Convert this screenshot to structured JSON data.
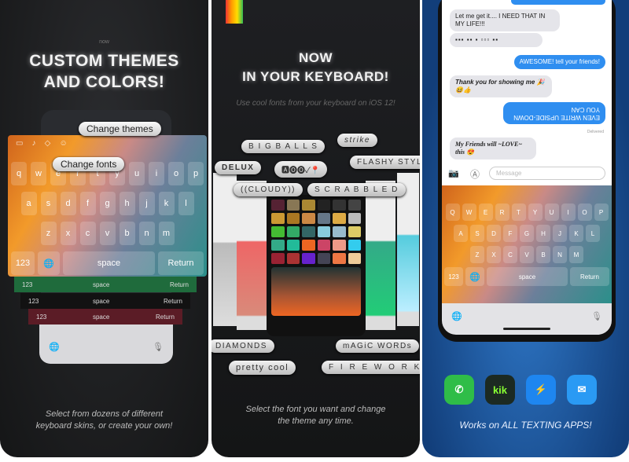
{
  "panel1": {
    "small_label": "now",
    "title_line1": "CUSTOM THEMES",
    "title_line2": "AND COLORS!",
    "tooltip_themes": "Change themes",
    "tooltip_fonts": "Change fonts",
    "keys_row1": [
      "q",
      "w",
      "e",
      "r",
      "t",
      "y",
      "u",
      "i",
      "o",
      "p"
    ],
    "keys_row2": [
      "a",
      "s",
      "d",
      "f",
      "g",
      "h",
      "j",
      "k",
      "l"
    ],
    "keys_row3": [
      "z",
      "x",
      "c",
      "v",
      "b",
      "n",
      "m"
    ],
    "key_123": "123",
    "key_space": "space",
    "key_return": "Return",
    "caption_line1": "Select from dozens of different",
    "caption_line2": "keyboard skins, or create your own!"
  },
  "panel2": {
    "title_line1": "NOW",
    "title_line2": "IN YOUR KEYBOARD!",
    "subtitle": "Use cool fonts from your keyboard on iOS 12!",
    "bubbles": [
      "B I G  B A L L S",
      "strike",
      "DELUX",
      "FLASHY STYLE",
      "((CLOUDY))",
      "S C R A B B L E D",
      "DIAMONDS",
      "mAGiC WORDs",
      "pretty cool",
      "F I R E W O R K S"
    ],
    "caption_line1": "Select the font you want and change",
    "caption_line2": "the theme any time."
  },
  "panel3": {
    "messages": [
      {
        "dir": "in",
        "text": "Let me get it.... I NEED THAT IN MY LIFE!!!"
      },
      {
        "dir": "in",
        "text": "▪▪▪ ▪▪ ▪ ▫▫▫ ▪▪"
      },
      {
        "dir": "out",
        "text": "AWESOME! tell your friends!"
      },
      {
        "dir": "in",
        "text": "Thank you for showing me 🎉😆👍"
      },
      {
        "dir": "out",
        "text": "EVEN WRITE UPSIDE-DOWN YOU CAN"
      },
      {
        "dir": "in",
        "text": "My Friends will ~LOVE~ this 😍"
      }
    ],
    "delivered": "Delivered",
    "message_placeholder": "Message",
    "keys_row1": [
      "Q",
      "W",
      "E",
      "R",
      "T",
      "Y",
      "U",
      "I",
      "O",
      "P"
    ],
    "keys_row2": [
      "A",
      "S",
      "D",
      "F",
      "G",
      "H",
      "J",
      "K",
      "L"
    ],
    "keys_row3": [
      "Z",
      "X",
      "C",
      "V",
      "B",
      "N",
      "M"
    ],
    "key_123": "123",
    "key_space": "space",
    "key_return": "Return",
    "apps": [
      {
        "icon": "whatsapp-icon",
        "label": "✆",
        "color": "#2fbd48"
      },
      {
        "icon": "kik-icon",
        "label": "kik",
        "color": "#1c2a22"
      },
      {
        "icon": "messenger-icon",
        "label": "⚡",
        "color": "#1e86f0"
      },
      {
        "icon": "mail-icon",
        "label": "✉",
        "color": "#2a9af4"
      }
    ],
    "caption": "Works on ALL TEXTING APPS!"
  }
}
